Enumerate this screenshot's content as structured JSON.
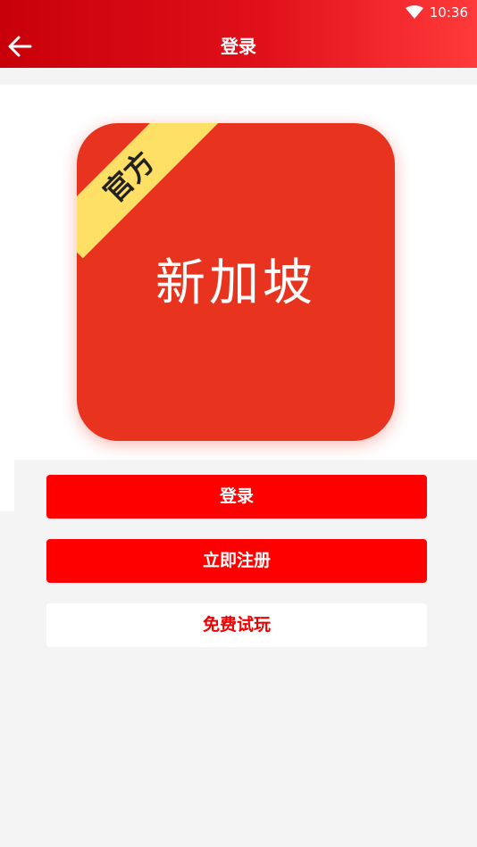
{
  "status_bar": {
    "time": "10:36",
    "wifi_icon": "wifi-icon"
  },
  "app_bar": {
    "title": "登录",
    "back_icon": "arrow-left-icon"
  },
  "logo": {
    "badge": "官方",
    "name": "新加坡",
    "background_color": "#e8331f",
    "badge_color": "#ffe066"
  },
  "actions": {
    "login": "登录",
    "register": "立即注册",
    "trial": "免费试玩"
  },
  "colors": {
    "primary": "#ff0000",
    "header": "#d8101a"
  }
}
